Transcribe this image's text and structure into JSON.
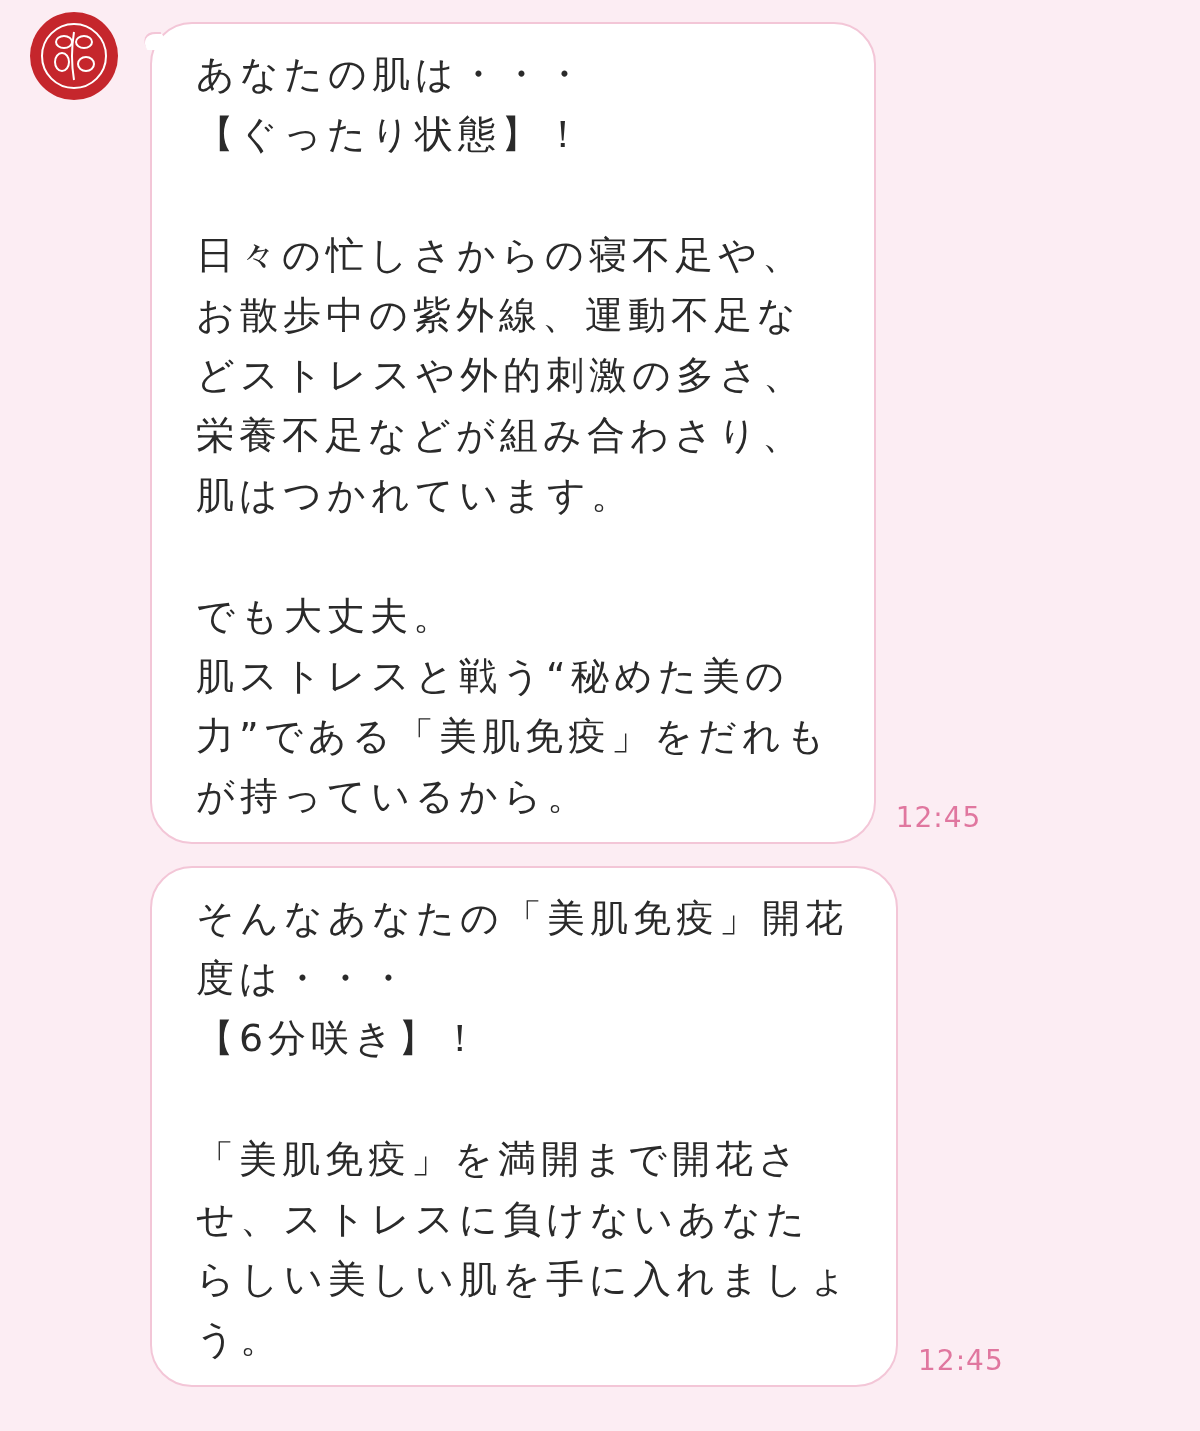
{
  "messages": [
    {
      "tail": true,
      "time": "12:45",
      "paragraphs": [
        {
          "lines": [
            "あなたの肌は・・・",
            "【ぐったり状態】！"
          ]
        },
        {
          "lines": [
            "日々の忙しさからの寝不足や、",
            "お散歩中の紫外線、運動不足な",
            "どストレスや外的刺激の多さ、",
            "栄養不足などが組み合わさり、",
            "肌はつかれています。"
          ]
        },
        {
          "lines": [
            "でも大丈夫。",
            "肌ストレスと戦う“秘めた美の",
            "力”である「美肌免疫」をだれも",
            "が持っているから。"
          ]
        }
      ]
    },
    {
      "tail": false,
      "time": "12:45",
      "paragraphs": [
        {
          "lines": [
            "そんなあなたの「美肌免疫」開花",
            "度は・・・",
            "【6分咲き】！"
          ]
        },
        {
          "lines": [
            "「美肌免疫」を満開まで開花さ",
            "せ、ストレスに負けないあなた",
            "らしい美しい肌を手に入れましょ",
            "う。"
          ]
        }
      ]
    }
  ]
}
